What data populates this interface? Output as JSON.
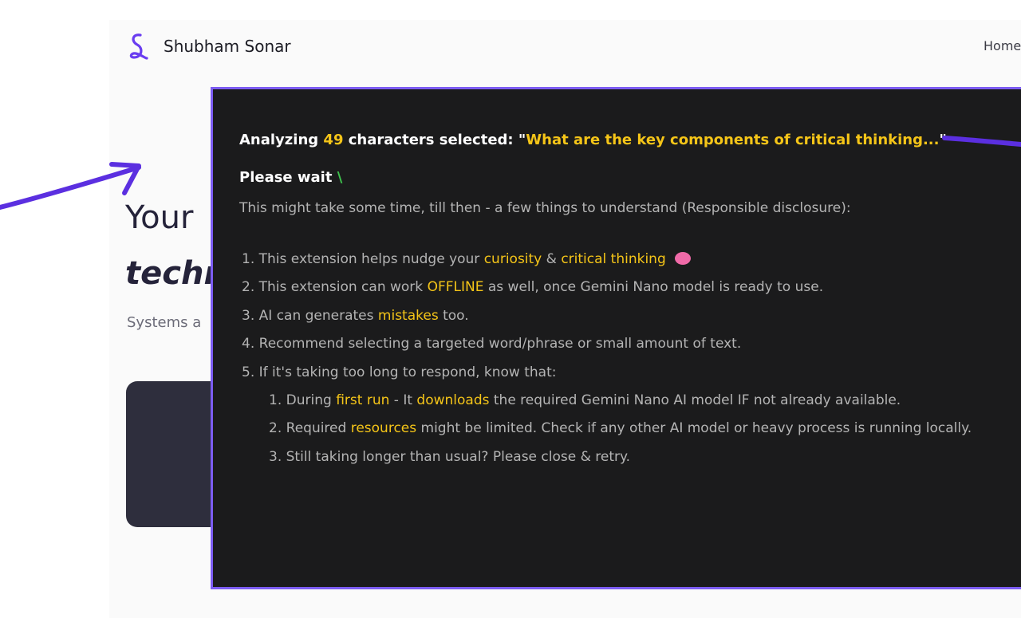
{
  "header": {
    "brand_name": "Shubham Sonar",
    "nav_home": "Home"
  },
  "hero": {
    "title_partial": "Your",
    "emphasis_partial": "techn",
    "subtitle_partial": "Systems a"
  },
  "popup": {
    "analyze": {
      "prefix": "Analyzing",
      "count": "49",
      "middle": "characters selected: \"",
      "selected_text": "What are the key components of critical thinking...",
      "suffix": "\""
    },
    "wait_label": "Please wait",
    "spinner_glyph": "\\",
    "intro": "This might take some time, till then - a few things to understand (Responsible disclosure):",
    "items": [
      {
        "num": "1.",
        "t1": "This extension helps nudge your",
        "h1": "curiosity",
        "t2": "&",
        "h2": "critical thinking",
        "icon": "brain-icon"
      },
      {
        "num": "2.",
        "t1": "This extension can work",
        "h1": "OFFLINE",
        "t2": "as well, once Gemini Nano model is ready to use."
      },
      {
        "num": "3.",
        "t1": "AI can generates",
        "h1": "mistakes",
        "t2": "too."
      },
      {
        "num": "4.",
        "t1": "Recommend selecting a targeted word/phrase or small amount of text."
      },
      {
        "num": "5.",
        "t1": "If it's taking too long to respond, know that:"
      }
    ],
    "subitems": [
      {
        "num": "1.",
        "t1": "During",
        "h1": "first run",
        "t2": "- It",
        "h2": "downloads",
        "t3": "the required Gemini Nano AI model IF not already available."
      },
      {
        "num": "2.",
        "t1": "Required",
        "h1": "resources",
        "t2": "might be limited. Check if any other AI model or heavy process is running locally."
      },
      {
        "num": "3.",
        "t1": "Still taking longer than usual? Please close & retry."
      }
    ]
  },
  "colors": {
    "highlight": "#f5c518",
    "overlay_border": "#7c5cf2",
    "overlay_bg": "#1b1b1c",
    "spinner": "#3ec24d",
    "arrow": "#5b2fe0"
  }
}
